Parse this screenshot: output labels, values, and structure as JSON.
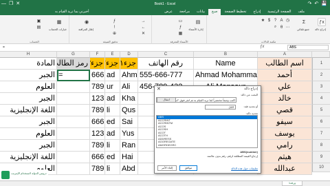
{
  "titlebar": {
    "title": "Book1 - Excel",
    "controls": [
      "—",
      "❐",
      "✕"
    ],
    "quick_access": [
      "💾",
      "↶",
      "↷"
    ]
  },
  "ribbon": {
    "tabs": [
      "ملف",
      "الصفحة الرئيسية",
      "إدراج",
      "تخطيط الصفحة",
      "صيغ",
      "بيانات",
      "مراجعة",
      "عرض"
    ],
    "active_tab": "صيغ",
    "tell_me": "أخبرني بما تريد القيام به",
    "groups": [
      "مكتبة الدالات",
      "الأسماء المعرفة",
      "تدقيق الصيغة",
      "الحساب"
    ],
    "buttons": {
      "insert_function": "إدراج دالة",
      "autosum": "جمع تلقائي",
      "name_manager": "إدارة الأسماء",
      "calc_options": "خيارات الحساب",
      "watch_window": "إطار المراقبة"
    }
  },
  "formula_bar": {
    "name_box": "ABS",
    "formula": "="
  },
  "columns": [
    "A",
    "B",
    "C",
    "D",
    "E",
    "F",
    "G",
    "H"
  ],
  "rows": [
    "1",
    "2",
    "3",
    "4",
    "5",
    "6",
    "7",
    "8",
    "9",
    "10",
    "11"
  ],
  "header_row": {
    "a": "اسم الطالب",
    "b": "Name",
    "c": "رقم الهاتف",
    "d": "جزء١",
    "e": "جزء٢",
    "f": "جزء٣",
    "g": "رمز الطالب",
    "h": "المادة"
  },
  "data_rows": [
    {
      "a": "أحمد",
      "b": "Ahmad Mohammad",
      "c": "555-666-777",
      "d": "Ahm",
      "e": "ad",
      "f": "666",
      "g": "=",
      "h": "الجبر"
    },
    {
      "a": "علي",
      "b": "Ali Mansour",
      "c": "456-789-432",
      "d": "Ali",
      "e": "ur",
      "f": "789",
      "g": "",
      "h": "العلوم"
    },
    {
      "a": "خالد",
      "b": "",
      "c": "",
      "d": "Kha",
      "e": "ad",
      "f": "123",
      "g": "",
      "h": "الجبر"
    },
    {
      "a": "قصي",
      "b": "",
      "c": "",
      "d": "Qus",
      "e": "li",
      "f": "789",
      "g": "",
      "h": "اللغة الإنجليزية"
    },
    {
      "a": "سيفو",
      "b": "",
      "c": "",
      "d": "Sai",
      "e": "ed",
      "f": "666",
      "g": "",
      "h": "الجبر"
    },
    {
      "a": "يوسف",
      "b": "",
      "c": "",
      "d": "Yus",
      "e": "ad",
      "f": "123",
      "g": "",
      "h": "العلوم"
    },
    {
      "a": "رامي",
      "b": "",
      "c": "",
      "d": "Ran",
      "e": "li",
      "f": "789",
      "g": "",
      "h": "الجبر"
    },
    {
      "a": "هيثم",
      "b": "",
      "c": "",
      "d": "Hai",
      "e": "ed",
      "f": "666",
      "g": "",
      "h": "اللغة الإنجليزية"
    },
    {
      "a": "عبدالله",
      "b": "",
      "c": "",
      "d": "Abd",
      "e": "li",
      "f": "789",
      "g": "",
      "h": "العلوم"
    }
  ],
  "dialog": {
    "title": "إدراج دالة",
    "search_label": "البحث عن دالة:",
    "search_value": "اكتب وصفاً مختصراً لما تريد القيام به ثم انقر فوق \"انتقال\"",
    "go_button": "انتقال",
    "category_label": "أو تحديد فئة:",
    "category_value": "الكل",
    "select_label": "تحديد دالة:",
    "functions": [
      "ABS",
      "ACCRINT",
      "ACCRINTM",
      "ACOS",
      "ACOSH",
      "ACOT",
      "ACOTH",
      "ADDRESS",
      "AGGREGATE",
      "AMORDEGRC"
    ],
    "selected_function": "ABS",
    "signature": "ABS(number)",
    "description": "إرجاع القيمة المطلقة لرقم، رقم بدون علامته.",
    "help_link": "تعليمات حول هذه الدالة",
    "ok_button": "موافق",
    "cancel_button": "إلغاء الأمر"
  },
  "logo": {
    "text": "دروس الدولة لاستخدام الإنترنت"
  },
  "sheet": {
    "tab": "ورقة1"
  }
}
